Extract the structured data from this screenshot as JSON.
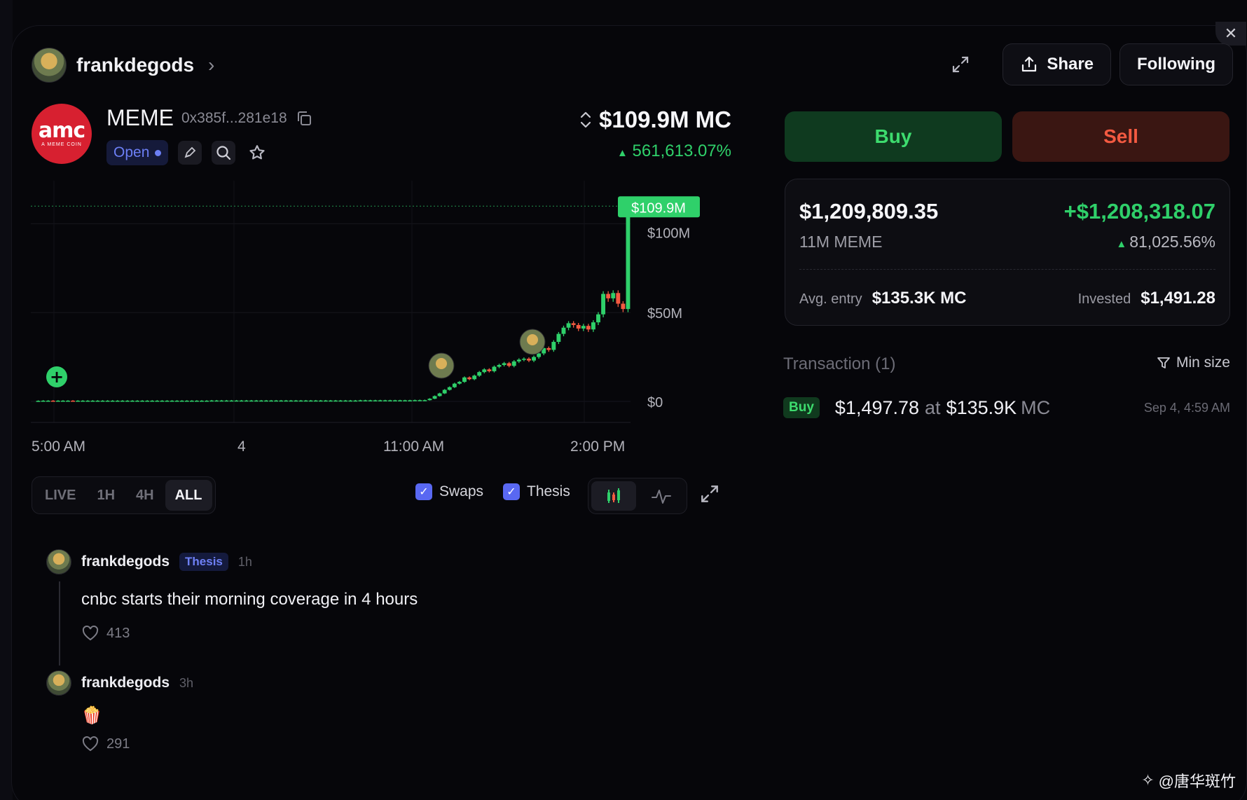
{
  "header": {
    "username": "frankdegods",
    "share_label": "Share",
    "following_label": "Following"
  },
  "token": {
    "logo_text": "amc",
    "logo_subtext": "A MEME COIN",
    "name": "MEME",
    "address": "0x385f...281e18",
    "status": "Open",
    "market_cap": "$109.9M MC",
    "change": "561,613.07%"
  },
  "chart": {
    "x_labels": [
      "5:00 AM",
      "4",
      "11:00 AM",
      "2:00 PM"
    ],
    "y_labels": [
      "$100M",
      "$50M",
      "$0"
    ],
    "current_price_label": "$109.9M",
    "ranges": [
      "LIVE",
      "1H",
      "4H",
      "ALL"
    ],
    "active_range": "ALL",
    "toggles": {
      "swaps_label": "Swaps",
      "thesis_label": "Thesis"
    }
  },
  "chart_data": {
    "type": "candlestick",
    "y_unit": "market cap (USD)",
    "ylim": [
      0,
      110000000
    ],
    "x_ticks": [
      "5:00 AM",
      "4",
      "11:00 AM",
      "2:00 PM"
    ],
    "y_ticks": [
      "$0",
      "$50M",
      "$100M"
    ],
    "last_value_label": "$109.9M",
    "series": [
      {
        "values": [
          0.3,
          0.4,
          0.4,
          0.3,
          0.4,
          0.4,
          0.4,
          0.3,
          0.4,
          0.4,
          0.4,
          0.4,
          0.4,
          0.4,
          0.4,
          0.4,
          0.4,
          0.4,
          0.4,
          0.4,
          0.4,
          0.4,
          0.4,
          0.4,
          0.4,
          0.4,
          0.4,
          0.4,
          0.4,
          0.4,
          0.4,
          0.4,
          0.4,
          0.4,
          0.4,
          0.5,
          0.5,
          0.5,
          0.5,
          0.5,
          0.5,
          0.5,
          0.5,
          0.5,
          0.5,
          0.5,
          0.5,
          0.5,
          0.5,
          0.5,
          0.5,
          0.5,
          0.5,
          0.5,
          0.5,
          0.5,
          0.5,
          0.5,
          0.5,
          0.5,
          0.5,
          0.5,
          0.5,
          0.5,
          0.5,
          0.6,
          0.6,
          0.6,
          0.6,
          0.6,
          0.6,
          0.6,
          0.6,
          0.6,
          0.6,
          0.6,
          0.7,
          0.7,
          0.7,
          1.5,
          3.0,
          4.5,
          6.5,
          8.0,
          10.0,
          11.0,
          13.5,
          12.5,
          14.5,
          16.5,
          18.0,
          17.0,
          19.5,
          20.5,
          21.5,
          20.0,
          22.5,
          23.5,
          24.0,
          23.0,
          25.0,
          27.0,
          30.0,
          29.0,
          33.5,
          38.0,
          41.5,
          44.0,
          43.0,
          41.0,
          42.5,
          40.5,
          44.5,
          49.0,
          60.5,
          58.0,
          61.0,
          55.0,
          52.0,
          109.9
        ]
      }
    ],
    "markers": [
      "start-plus",
      "avatar",
      "avatar"
    ]
  },
  "trade": {
    "buy_label": "Buy",
    "sell_label": "Sell"
  },
  "position": {
    "value": "$1,209,809.35",
    "pnl": "+$1,208,318.07",
    "amount": "11M MEME",
    "pnl_pct": "81,025.56%",
    "avg_entry_label": "Avg. entry",
    "avg_entry_value": "$135.3K MC",
    "invested_label": "Invested",
    "invested_value": "$1,491.28"
  },
  "transactions": {
    "title": "Transaction (1)",
    "min_size_label": "Min size",
    "rows": [
      {
        "side": "Buy",
        "amount": "$1,497.78",
        "at": "at",
        "mc": "$135.9K",
        "mc_unit": "MC",
        "date": "Sep 4, 4:59 AM"
      }
    ]
  },
  "posts": [
    {
      "author": "frankdegods",
      "tag": "Thesis",
      "time": "1h",
      "text": "cnbc starts their morning coverage in 4 hours",
      "likes": "413"
    },
    {
      "author": "frankdegods",
      "time": "3h",
      "text": "🍿",
      "likes": "291"
    }
  ],
  "watermark": "@唐华斑竹",
  "colors": {
    "up": "#2fd06a",
    "down": "#f35a41",
    "accent": "#5968f2",
    "background": "#06060a"
  }
}
